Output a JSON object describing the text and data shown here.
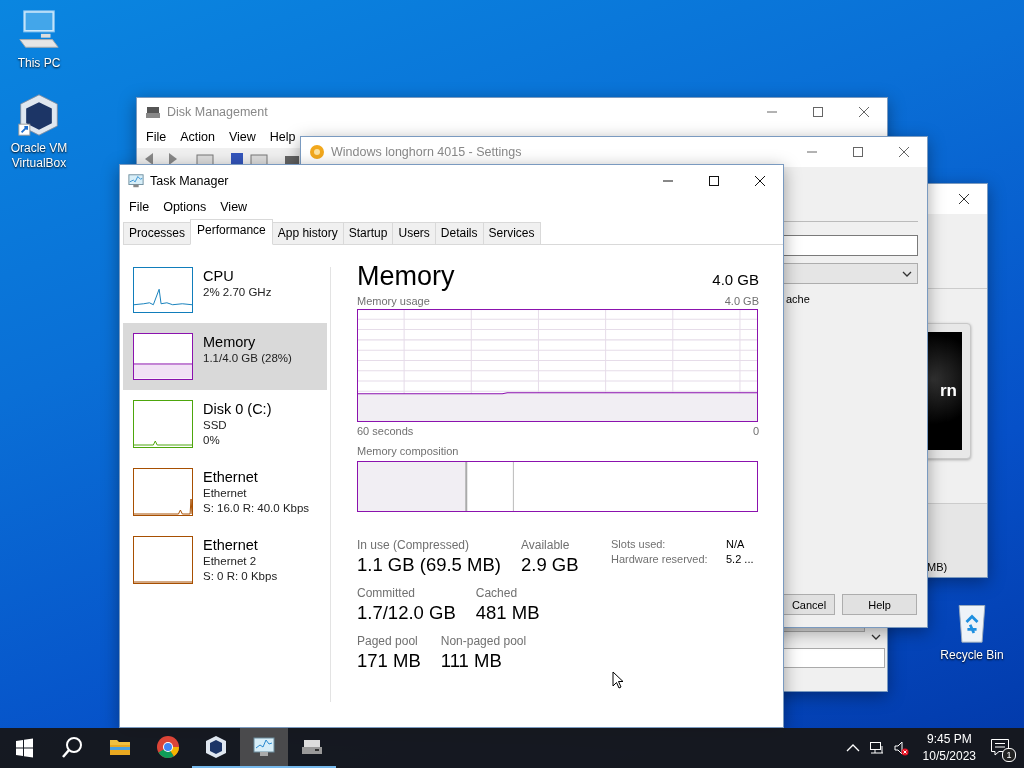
{
  "desktop": {
    "left_icons": [
      {
        "label": "This PC",
        "kind": "computer"
      },
      {
        "label": "Oracle VM VirtualBox",
        "kind": "virtualbox"
      }
    ],
    "right_icons": [
      {
        "label": "Recycle Bin",
        "kind": "recycle"
      }
    ]
  },
  "back_window": {
    "screen_text": "rn",
    "footer_text": "MB)"
  },
  "disk_management": {
    "title": "Disk Management",
    "menu": [
      "File",
      "Action",
      "View",
      "Help"
    ]
  },
  "settings_window": {
    "title": "Windows longhorn 4015 - Settings",
    "option_text": "ache",
    "buttons": [
      "Cancel",
      "Help"
    ]
  },
  "task_manager": {
    "title": "Task Manager",
    "menu": [
      "File",
      "Options",
      "View"
    ],
    "tabs": [
      {
        "label": "Processes",
        "selected": false
      },
      {
        "label": "Performance",
        "selected": true
      },
      {
        "label": "App history",
        "selected": false
      },
      {
        "label": "Startup",
        "selected": false
      },
      {
        "label": "Users",
        "selected": false
      },
      {
        "label": "Details",
        "selected": false
      },
      {
        "label": "Services",
        "selected": false
      }
    ],
    "resources": [
      {
        "name": "CPU",
        "lines": [
          "2%  2.70 GHz"
        ],
        "selected": false,
        "color": "#117dbb"
      },
      {
        "name": "Memory",
        "lines": [
          "1.1/4.0 GB (28%)"
        ],
        "selected": true,
        "color": "#8b12ae"
      },
      {
        "name": "Disk 0 (C:)",
        "lines": [
          "SSD",
          "0%"
        ],
        "selected": false,
        "color": "#4da60c"
      },
      {
        "name": "Ethernet",
        "lines": [
          "Ethernet",
          "S: 16.0 R: 40.0 Kbps"
        ],
        "selected": false,
        "color": "#a74f01"
      },
      {
        "name": "Ethernet",
        "lines": [
          "Ethernet 2",
          "S: 0 R: 0 Kbps"
        ],
        "selected": false,
        "color": "#a74f01"
      }
    ],
    "detail": {
      "heading": "Memory",
      "total": "4.0 GB",
      "usage_label": "Memory usage",
      "usage_max": "4.0 GB",
      "time_span": "60 seconds",
      "time_end": "0",
      "composition_label": "Memory composition",
      "stat_rows": [
        [
          {
            "label": "In use (Compressed)",
            "value": "1.1 GB (69.5 MB)"
          },
          {
            "label": "Available",
            "value": "2.9 GB"
          }
        ],
        [
          {
            "label": "Committed",
            "value": "1.7/12.0 GB"
          },
          {
            "label": "Cached",
            "value": "481 MB"
          }
        ],
        [
          {
            "label": "Paged pool",
            "value": "171 MB"
          },
          {
            "label": "Non-paged pool",
            "value": "111 MB"
          }
        ]
      ],
      "properties": [
        {
          "label": "Slots used:",
          "value": "N/A"
        },
        {
          "label": "Hardware reserved:",
          "value": "5.2 ..."
        }
      ]
    }
  },
  "taskbar": {
    "apps": [
      {
        "kind": "folder",
        "running": false,
        "selected": false
      },
      {
        "kind": "browser",
        "running": false,
        "selected": false
      },
      {
        "kind": "cube",
        "running": true,
        "selected": false
      },
      {
        "kind": "monitor",
        "running": true,
        "selected": true
      },
      {
        "kind": "drive",
        "running": true,
        "selected": false
      }
    ],
    "time": "9:45 PM",
    "date": "10/5/2023",
    "notifications": "1"
  }
}
